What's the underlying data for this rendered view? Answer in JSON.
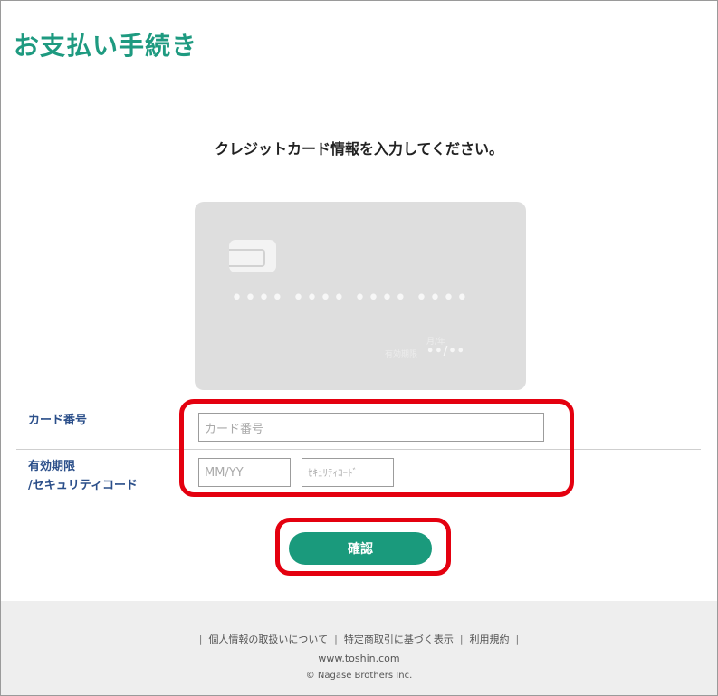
{
  "page": {
    "title": "お支払い手続き"
  },
  "instruction": "クレジットカード情報を入力してください。",
  "card_preview": {
    "number_groups": [
      "••••",
      "••••",
      "••••",
      "••••"
    ],
    "expiry_caption": "月/年",
    "expiry_label": "有効期限",
    "expiry_mask": "••/••"
  },
  "form": {
    "card_number": {
      "label": "カード番号",
      "placeholder": "カード番号"
    },
    "expiry": {
      "label_line1": "有効期限",
      "label_line2": "/セキュリティコード",
      "placeholder": "MM/YY"
    },
    "security_code": {
      "placeholder": "ｾｷｭﾘﾃｨｺｰﾄﾞ"
    }
  },
  "confirm_button": {
    "label": "確認"
  },
  "footer": {
    "links": [
      "個人情報の取扱いについて",
      "特定商取引に基づく表示",
      "利用規約"
    ],
    "url": "www.toshin.com",
    "copyright": "© Nagase Brothers Inc."
  },
  "colors": {
    "accent": "#1e9a80",
    "button": "#1a9a7c",
    "label": "#2b4f8a",
    "highlight": "#e4000f",
    "card": "#dedede"
  }
}
